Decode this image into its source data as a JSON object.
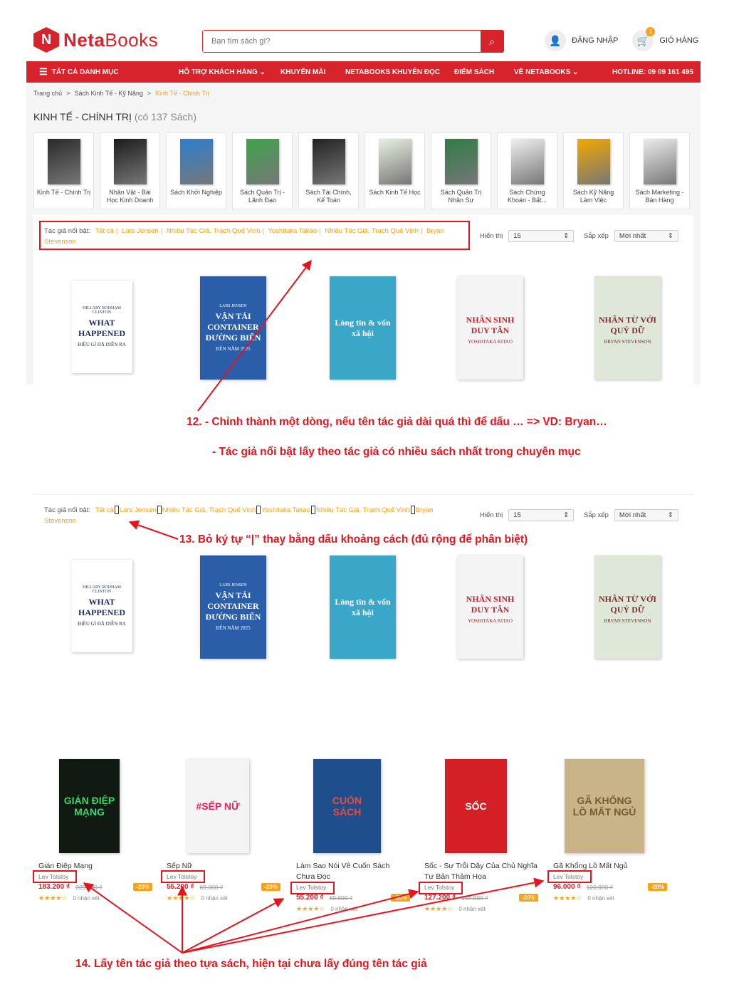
{
  "header": {
    "logo_mark": "N",
    "logo_bold": "Neta",
    "logo_rest": "Books",
    "search_placeholder": "Bạn tìm sách gì?",
    "login": "ĐĂNG NHẬP",
    "cart": "GIỎ HÀNG",
    "cart_count": "1"
  },
  "nav": {
    "all_categories": "TẤT CẢ DANH MỤC",
    "items": [
      "HỖ TRỢ KHÁCH HÀNG ⌄",
      "KHUYẾN MÃI",
      "NETABOOKS KHUYÊN ĐỌC",
      "ĐIỂM SÁCH",
      "VỀ NETABOOKS ⌄"
    ],
    "hotline": "HOTLINE: 09 09 161 495"
  },
  "breadcrumb": [
    "Trang chủ",
    ">",
    "Sách Kinh Tế - Kỹ Năng",
    ">",
    "Kinh Tế - Chính Trị"
  ],
  "category_title": "KINH TẾ - CHÍNH TRỊ",
  "category_count": "(có 137 Sách)",
  "categories": [
    {
      "name": "Kinh Tế - Chính Trị",
      "color": "#2a2a2a"
    },
    {
      "name": "Nhân Vật - Bài Học Kinh Doanh",
      "color": "#1c1c1c"
    },
    {
      "name": "Sách Khởi Nghiệp",
      "color": "#2b7fd1"
    },
    {
      "name": "Sách Quản Trị - Lãnh Đạo",
      "color": "#3fa34d"
    },
    {
      "name": "Sách Tài Chính, Kế Toán",
      "color": "#222222"
    },
    {
      "name": "Sách Kinh Tế Học",
      "color": "#e8efe0"
    },
    {
      "name": "Sách Quản Trị Nhân Sự",
      "color": "#2f7d45"
    },
    {
      "name": "Sách Chứng Khoán - Bất...",
      "color": "#f0f0f0"
    },
    {
      "name": "Sách Kỹ Năng Làm Việc",
      "color": "#f2a800"
    },
    {
      "name": "Sách Marketing - Bán Hàng",
      "color": "#ececec"
    }
  ],
  "filter": {
    "label": "Tác giả nổi bật:",
    "authors": [
      "Tất cả",
      "Lars Jensen",
      "Nhiều Tác Giả, Trạch Quế Vinh",
      "Yoshitaka Takao",
      "Nhiều Tác Giả, Trạch Quế Vinh",
      "Bryan"
    ],
    "authors_wrap": "Stevenson",
    "separator": "|",
    "show_label": "Hiển thị",
    "show_value": "15",
    "sort_label": "Sắp xếp",
    "sort_value": "Mới nhất"
  },
  "books_row": [
    {
      "title_top": "HILLARY RODHAM CLINTON",
      "title": "WHAT HAPPENED",
      "sub": "ĐIỀU GÌ ĐÃ DIỄN RA"
    },
    {
      "title_top": "LARS JENSEN",
      "title": "VẬN TẢI CONTAINER ĐƯỜNG BIỂN",
      "sub": "ĐẾN NĂM 2025"
    },
    {
      "title_top": "",
      "title": "Lòng tin & vốn xã hội",
      "sub": ""
    },
    {
      "title_top": "",
      "title": "NHÂN SINH DUY TÂN",
      "sub": "YOSHITAKA KITAO"
    },
    {
      "title_top": "",
      "title": "NHÂN TỪ VỚI QUỶ DỮ",
      "sub": "BRYAN STEVENSON"
    }
  ],
  "notes": {
    "n12a": "12.  - Chỉnh thành một dòng, nếu tên tác giả dài quá thì để dấu … => VD: Bryan…",
    "n12b": "- Tác giả nổi bật lấy theo tác giả có nhiều sách nhất trong chuyên mục",
    "n13": "13.  Bỏ ký tự “|” thay bằng dấu khoảng cách (đủ rộng để phân biệt)",
    "n14": "14. Lấy tên tác giả theo tựa sách, hiện tại chưa lấy đúng tên tác giả"
  },
  "products": [
    {
      "title": "Gián Điệp Mạng",
      "author": "Lev Tolstoy",
      "price": "183.200 ₫",
      "old": "229.000 ₫",
      "discount": "-20%",
      "stars": "★★★★☆",
      "reviews": "0 nhận xét",
      "cover": "#101a12",
      "accent": "#3ed36b",
      "cover_text": "GIÁN ĐIỆP MẠNG"
    },
    {
      "title": "Sếp Nữ",
      "author": "Lev Tolstoy",
      "price": "55.200 ₫",
      "old": "69.000 ₫",
      "discount": "-20%",
      "stars": "★★★★☆",
      "reviews": "0 nhận xét",
      "cover": "#f4f4f4",
      "accent": "#e0245e",
      "cover_text": "#SẾP NỮ"
    },
    {
      "title": "Làm Sao Nói Về Cuốn Sách Chưa Đọc",
      "author": "Lev Tolstoy",
      "price": "55.200 ₫",
      "old": "69.000 ₫",
      "discount": "-20%",
      "stars": "★★★★☆",
      "reviews": "0 nhận xét",
      "cover": "#1f4e8c",
      "accent": "#e94b3c",
      "cover_text": "CUỐN SÁCH"
    },
    {
      "title": "Sốc - Sự Trỗi Dậy Của Chủ Nghĩa Tư Bản Thảm Họa",
      "author": "Lev Tolstoy",
      "price": "127.200 ₫",
      "old": "159.000 ₫",
      "discount": "-20%",
      "stars": "★★★★☆",
      "reviews": "0 nhận xét",
      "cover": "#d41f24",
      "accent": "#ffffff",
      "cover_text": "SỐC"
    },
    {
      "title": "Gã Khổng Lồ Mất Ngủ",
      "author": "Lev Tolstoy",
      "price": "96.000 ₫",
      "old": "120.000 ₫",
      "discount": "-20%",
      "stars": "★★★★☆",
      "reviews": "0 nhận xét",
      "cover": "#c9b48a",
      "accent": "#7a5a2c",
      "cover_text": "GÃ KHỔNG LỒ MẤT NGỦ"
    }
  ]
}
